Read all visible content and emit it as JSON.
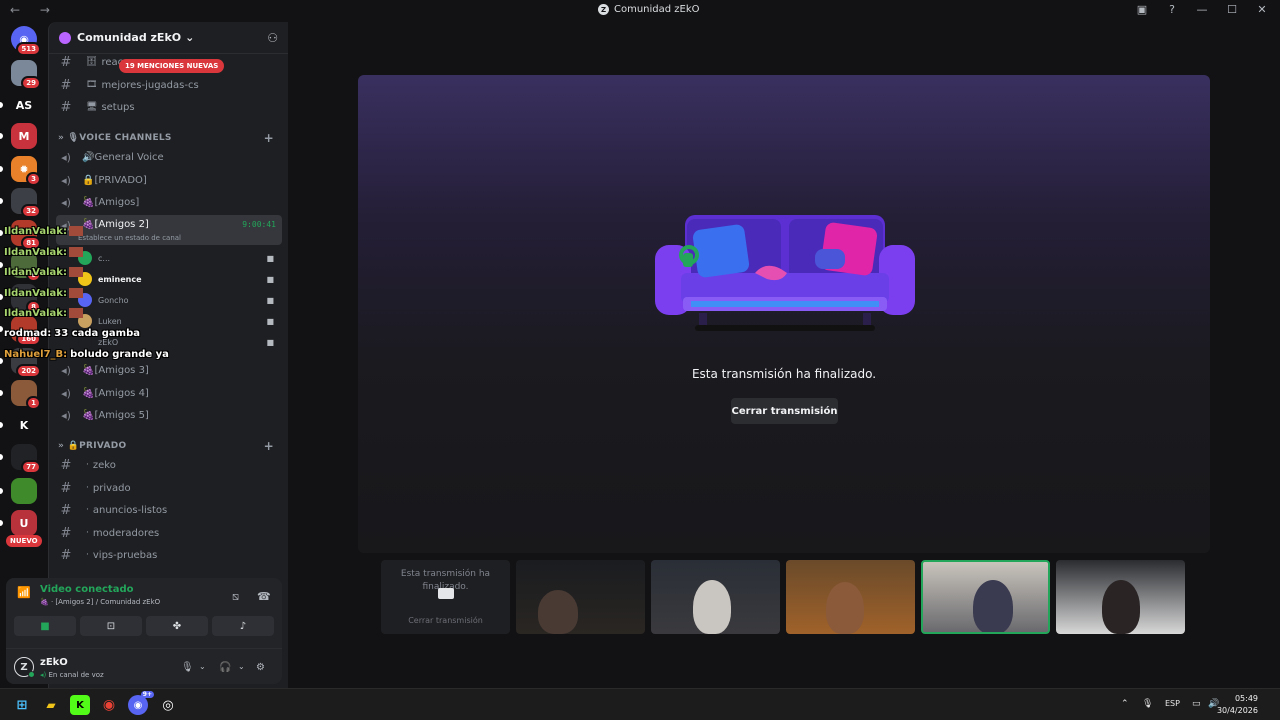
{
  "window": {
    "title": "Comunidad zEkO",
    "logo_letter": "Z",
    "back_forward": "← →"
  },
  "titlebar_icons": [
    "inbox-icon",
    "help-icon",
    "minimize-icon",
    "maximize-icon",
    "close-icon"
  ],
  "guilds": [
    {
      "name": "discord-home",
      "badge": "513",
      "color": "#5865f2",
      "glyph": "◉"
    },
    {
      "name": "server-1",
      "badge": "29",
      "color": "#7a8899",
      "glyph": ""
    },
    {
      "name": "server-as",
      "badge": "",
      "color": "#121214",
      "glyph": "AS"
    },
    {
      "name": "server-red",
      "badge": "",
      "color": "#c8323c",
      "glyph": "M"
    },
    {
      "name": "server-sun",
      "badge": "3",
      "color": "#e8812a",
      "glyph": "✹"
    },
    {
      "name": "server-5",
      "badge": "32",
      "color": "#3c3f45",
      "glyph": ""
    },
    {
      "name": "server-6",
      "badge": "81",
      "color": "#b23a2a",
      "glyph": ""
    },
    {
      "name": "server-7",
      "badge": "6",
      "color": "#4c6a3a",
      "glyph": ""
    },
    {
      "name": "server-8",
      "badge": "8",
      "color": "#2f3136",
      "glyph": ""
    },
    {
      "name": "server-9",
      "badge": "160",
      "color": "#b23a2a",
      "glyph": ""
    },
    {
      "name": "server-10",
      "badge": "202",
      "color": "#3a3c42",
      "glyph": ""
    },
    {
      "name": "server-11",
      "badge": "1",
      "color": "#8a5a3a",
      "glyph": ""
    },
    {
      "name": "server-kick",
      "badge": "",
      "color": "#121214",
      "glyph": "K"
    },
    {
      "name": "server-13",
      "badge": "77",
      "color": "#202225",
      "glyph": ""
    },
    {
      "name": "server-14",
      "badge": "",
      "color": "#3f8a2a",
      "glyph": ""
    },
    {
      "name": "server-15",
      "badge": "",
      "color": "#b8323c",
      "glyph": "U"
    }
  ],
  "nuevo_label": "NUEVO",
  "server": {
    "name": "Comunidad zEkO",
    "mentions": "19 MENCIONES NUEVAS"
  },
  "top_channels": [
    {
      "label": "reac",
      "emoji": "🗄"
    },
    {
      "label": "mejores-jugadas-cs",
      "emoji": "🎞"
    },
    {
      "label": "setups",
      "emoji": "🖥"
    }
  ],
  "voice_category": "VOICE CHANNELS",
  "voice_channels": [
    {
      "label": "General Voice",
      "emoji": "🔊"
    },
    {
      "label": "[PRIVADO]",
      "emoji": "🔒"
    },
    {
      "label": "[Amigos]",
      "emoji": "🍇"
    },
    {
      "label": "[Amigos 2]",
      "emoji": "🍇",
      "timer": "9:00:41",
      "status": "Establece un estado de canal"
    }
  ],
  "voice_users": [
    {
      "name": "c...",
      "av": "#23a55a"
    },
    {
      "name": "eminence",
      "av": "#f0c419"
    },
    {
      "name": "Goncho",
      "av": "#5865f2"
    },
    {
      "name": "Luken",
      "av": "#c8a060"
    },
    {
      "name": "zEkO",
      "av": "#1e1f22"
    }
  ],
  "voice_channels_2": [
    {
      "label": "[Amigos 3]",
      "emoji": "🍇"
    },
    {
      "label": "[Amigos 4]",
      "emoji": "🍇"
    },
    {
      "label": "[Amigos 5]",
      "emoji": "🍇"
    }
  ],
  "private_category": "PRIVADO",
  "private_channels": [
    "zeko",
    "privado",
    "anuncios-listos",
    "moderadores",
    "vips-pruebas"
  ],
  "chat_overlay": [
    {
      "user": "IldanValak:",
      "msg": ""
    },
    {
      "user": "IldanValak:",
      "msg": ""
    },
    {
      "user": "IldanValak:",
      "msg": ""
    },
    {
      "user": "IldanValak:",
      "msg": ""
    },
    {
      "user": "IldanValak:",
      "msg": ""
    },
    {
      "user": "rodmad:",
      "msg": "33 cada gamba"
    },
    {
      "user": "Nahuel7_B:",
      "msg": "boludo grande ya"
    }
  ],
  "voice_panel": {
    "title": "Video conectado",
    "subtitle": "[Amigos 2] / Comunidad zEkO",
    "buttons": [
      "camera-icon",
      "screenshare-icon",
      "activities-icon",
      "soundboard-icon"
    ]
  },
  "user": {
    "name": "zEkO",
    "status": "En canal de voz",
    "initial": "Z"
  },
  "stage": {
    "message": "Esta transmisión ha finalizado.",
    "button": "Cerrar transmisión"
  },
  "tiles": {
    "ended_text": "Esta transmisión ha finalizado.",
    "ended_button": "Cerrar transmisión"
  },
  "taskbar": {
    "lang": "ESP",
    "time": "05:49",
    "date": "30/4/2026",
    "discord_badge": "9+"
  },
  "colors": {
    "accent_green": "#23a55a",
    "mention_red": "#da373c",
    "brand": "#5865f2"
  }
}
